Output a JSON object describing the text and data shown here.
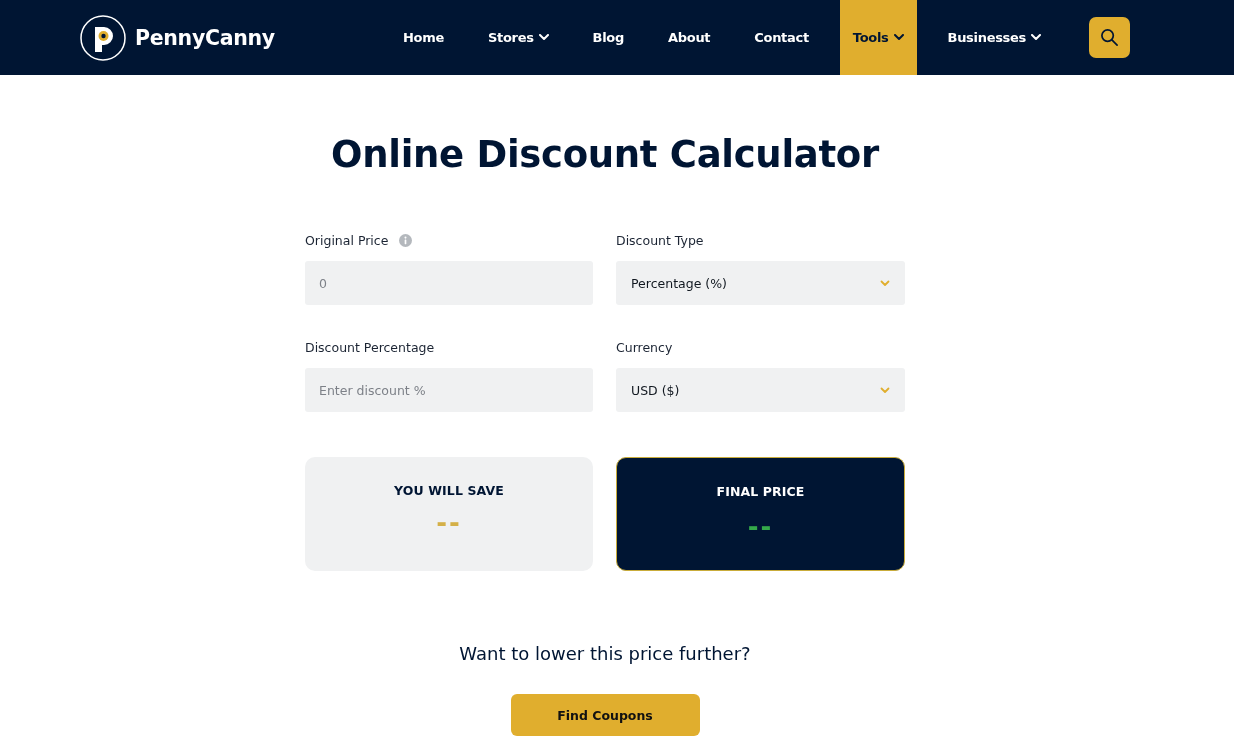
{
  "header": {
    "brand": "PennyCanny",
    "nav": [
      {
        "label": "Home",
        "dropdown": false,
        "selected": false
      },
      {
        "label": "Stores",
        "dropdown": true,
        "selected": false
      },
      {
        "label": "Blog",
        "dropdown": false,
        "selected": false
      },
      {
        "label": "About",
        "dropdown": false,
        "selected": false
      },
      {
        "label": "Contact",
        "dropdown": false,
        "selected": false
      },
      {
        "label": "Tools",
        "dropdown": true,
        "selected": true
      },
      {
        "label": "Businesses",
        "dropdown": true,
        "selected": false
      }
    ]
  },
  "title": "Online Discount Calculator",
  "fields": [
    {
      "kind": "input",
      "label": "Original Price",
      "info": true,
      "placeholder": "0"
    },
    {
      "kind": "select",
      "label": "Discount Type",
      "value": "Percentage (%)"
    },
    {
      "kind": "input",
      "label": "Discount Percentage",
      "info": false,
      "placeholder": "Enter discount %"
    },
    {
      "kind": "select",
      "label": "Currency",
      "value": "USD ($)"
    }
  ],
  "results": [
    {
      "kind": "savings",
      "label": "YOU WILL SAVE",
      "value": "--"
    },
    {
      "kind": "total",
      "label": "FINAL PRICE",
      "value": "--"
    }
  ],
  "cta": {
    "prompt": "Want to lower this price further?",
    "button": "Find Coupons"
  }
}
